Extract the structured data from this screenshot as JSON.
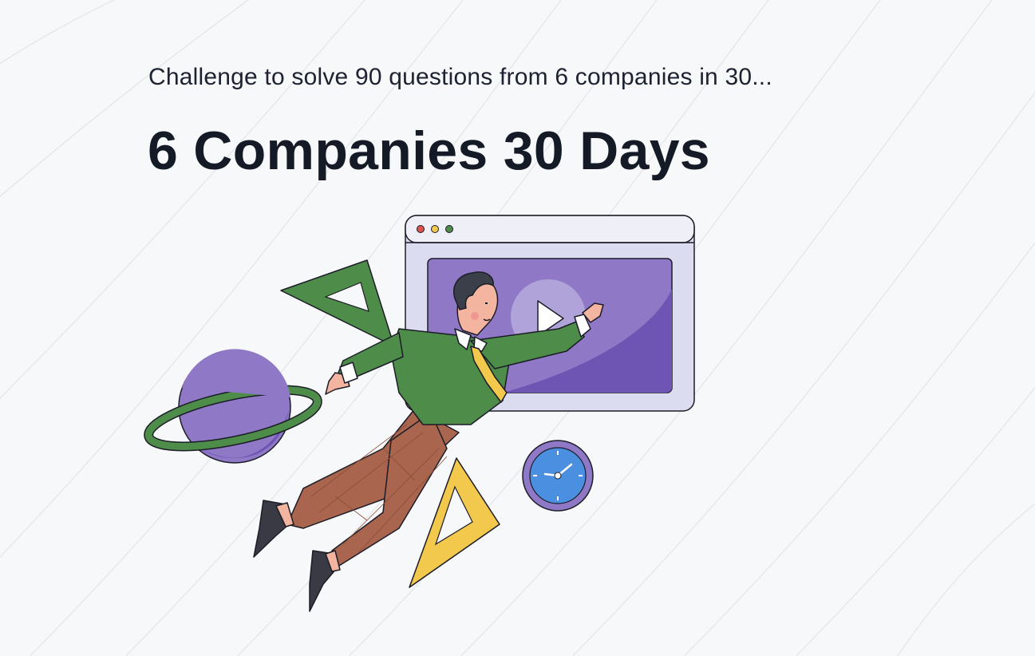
{
  "header": {
    "subtitle": "Challenge to solve 90 questions from 6 companies in 30...",
    "title": "6 Companies 30 Days"
  },
  "illustration": {
    "icons": [
      "browser-window-icon",
      "play-icon",
      "planet-icon",
      "set-square-icon",
      "clock-icon",
      "person-figure"
    ]
  },
  "colors": {
    "background": "#f7f8fa",
    "text": "#141a26",
    "purple": "#8f79c7",
    "green": "#4e8c4a",
    "yellow": "#f2c94c",
    "brown": "#a9654d",
    "blue": "#4a8fe0"
  }
}
